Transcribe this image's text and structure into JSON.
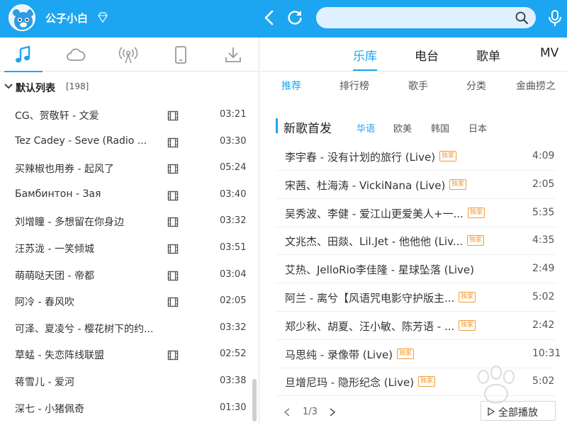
{
  "header": {
    "username": "公子小白",
    "search": {
      "value": "",
      "placeholder": ""
    }
  },
  "sidebar": {
    "tabs": [
      {
        "icon": "music-note-icon",
        "active": true
      },
      {
        "icon": "cloud-icon",
        "active": false
      },
      {
        "icon": "radio-icon",
        "active": false
      },
      {
        "icon": "device-icon",
        "active": false
      },
      {
        "icon": "download-icon",
        "active": false
      }
    ],
    "list_title": "默认列表",
    "list_count": "[198]",
    "songs": [
      {
        "name": "CG、贺敬轩 - 文爱",
        "mv": true,
        "time": "03:21"
      },
      {
        "name": "Tez Cadey - Seve (Radio ...",
        "mv": true,
        "time": "03:30"
      },
      {
        "name": "买辣椒也用券 - 起风了",
        "mv": true,
        "time": "05:24"
      },
      {
        "name": "Бамбинтон - Зая",
        "mv": true,
        "time": "03:40"
      },
      {
        "name": "刘增瞳 - 多想留在你身边",
        "mv": true,
        "time": "03:32"
      },
      {
        "name": "汪苏泷 - 一笑倾城",
        "mv": true,
        "time": "03:51"
      },
      {
        "name": "萌萌哒天团 - 帝都",
        "mv": true,
        "time": "03:04"
      },
      {
        "name": "阿冷 - 春风吹",
        "mv": true,
        "time": "02:05"
      },
      {
        "name": "可泽、夏凌兮 - 樱花树下的约...",
        "mv": false,
        "time": "03:32"
      },
      {
        "name": "草蜢 - 失恋阵线联盟",
        "mv": true,
        "time": "02:52"
      },
      {
        "name": "蒋雪儿 - 爱河",
        "mv": false,
        "time": "03:38"
      },
      {
        "name": "深七 - 小猪佩奇",
        "mv": false,
        "time": "01:30"
      }
    ]
  },
  "main": {
    "tabs": [
      "乐库",
      "电台",
      "歌单",
      "MV"
    ],
    "active_tab": "乐库",
    "sub_tabs": [
      "推荐",
      "排行榜",
      "歌手",
      "分类",
      "金曲捞之"
    ],
    "active_sub_tab": "推荐",
    "section_title": "新歌首发",
    "lang_tabs": [
      "华语",
      "欧美",
      "韩国",
      "日本"
    ],
    "active_lang_tab": "华语",
    "new_songs": [
      {
        "name": "李宇春 - 没有计划的旅行 (Live)",
        "badge": "独家",
        "time": "4:09"
      },
      {
        "name": "宋茜、杜海涛 - VickiNana (Live)",
        "badge": "独家",
        "time": "2:05"
      },
      {
        "name": "吴秀波、李健 - 爱江山更爱美人+一...",
        "badge": "独家",
        "time": "5:35"
      },
      {
        "name": "文兆杰、田燚、Lil.Jet - 他他他 (Liv...",
        "badge": "独家",
        "time": "4:35"
      },
      {
        "name": "艾热、JelloRio李佳隆 - 星球坠落 (Live)",
        "badge": "",
        "time": "2:49"
      },
      {
        "name": "阿兰 - 离兮【风语咒电影守护版主...",
        "badge": "独家",
        "time": "5:02"
      },
      {
        "name": "郑少秋、胡夏、汪小敏、陈芳语 - ...",
        "badge": "独家",
        "time": "2:42"
      },
      {
        "name": "马思纯 - 录像带 (Live)",
        "badge": "独家",
        "time": "10:31"
      },
      {
        "name": "旦增尼玛 - 隐形纪念 (Live)",
        "badge": "独家",
        "time": "5:02"
      }
    ],
    "pager": "1/3",
    "play_all_label": "全部播放"
  },
  "colors": {
    "accent": "#1ca5f1",
    "badge": "#f39a33"
  }
}
